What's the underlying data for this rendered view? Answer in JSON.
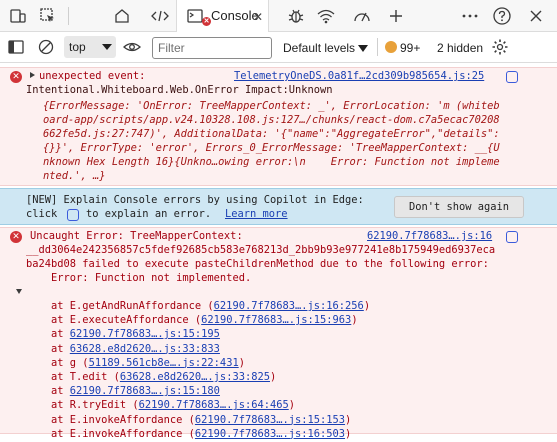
{
  "tabbar": {
    "console_label": "Console",
    "close_glyph": "✕",
    "error_badge": "✕",
    "icons": [
      "device-emulation-icon",
      "inspect-icon",
      "welcome-icon",
      "elements-icon",
      "console-icon",
      "debug-icon",
      "network-icon",
      "performance-icon",
      "more-tools-icon",
      "more-options-icon",
      "help-icon",
      "close-devtools-icon"
    ]
  },
  "toolbar": {
    "context": "top",
    "filter_placeholder": "Filter",
    "levels_label": "Default levels",
    "issues_count": "99+",
    "hidden_count": "2 hidden"
  },
  "messages": {
    "first": {
      "header": "unexpected event:",
      "source": "TelemetryOneDS.0a81f…2cd309b985654.js:25",
      "line2": "Intentional.Whiteboard.Web.OnError Impact:Unknown",
      "obj_lines": [
        "{ErrorMessage: 'OnError: TreeMapperContext: _', ErrorLocation: 'm (whiteb",
        "oard-app/scripts/app.v24.10328.108.js:127…/chunks/react-dom.c7a5ecac70208",
        "662fe5d.js:27:747)', AdditionalData: '{\"name\":\"AggregateError\",\"details\":",
        "{}}', ErrorType: 'error', Errors_0_ErrorMessage: 'TreeMapperContext: __{U",
        "nknown Hex Length 16}{Unkno…owing error:\\n    Error: Function not impleme",
        "nted.', …}"
      ]
    },
    "copilot": {
      "line1": "[NEW] Explain Console errors by using Copilot in Edge:",
      "line2_pre": "click",
      "line2_post": "to explain an error.",
      "learn_more": "Learn more",
      "dont_show": "Don't show again"
    },
    "second": {
      "header": "Uncaught Error: TreeMapperContext:",
      "header_source": "62190.7f78683….js:16",
      "lines": [
        "__dd3064e242356857c5fdef92685cb583e768213d_2bb9b93e977241e8b175949ed6937eca",
        "ba24bd08 failed to execute pasteChildrenMethod due to the following error:",
        "    Error: Function not implemented."
      ],
      "stack": [
        {
          "fn": "    at E.getAndRunAffordance (",
          "src": "62190.7f78683….js:16:256",
          "end": ")"
        },
        {
          "fn": "    at E.executeAffordance (",
          "src": "62190.7f78683….js:15:963",
          "end": ")"
        },
        {
          "fn": "    at ",
          "src": "62190.7f78683….js:15:195",
          "end": ""
        },
        {
          "fn": "    at ",
          "src": "63628.e8d2620….js:33:833",
          "end": ""
        },
        {
          "fn": "    at g (",
          "src": "51189.561cb8e….js:22:431",
          "end": ")"
        },
        {
          "fn": "    at T.edit (",
          "src": "63628.e8d2620….js:33:825",
          "end": ")"
        },
        {
          "fn": "    at ",
          "src": "62190.7f78683….js:15:180",
          "end": ""
        },
        {
          "fn": "    at R.tryEdit (",
          "src": "62190.7f78683….js:64:465",
          "end": ")"
        },
        {
          "fn": "    at E.invokeAffordance (",
          "src": "62190.7f78683….js:15:153",
          "end": ")"
        },
        {
          "fn": "    at E.invokeAffordance (",
          "src": "62190.7f78683….js:16:503",
          "end": ")"
        }
      ]
    }
  },
  "colors": {
    "error_red": "#d13438",
    "error_bg": "#fdf0f0",
    "copilot_bg": "#cfe7f3",
    "link_blue": "#1a3fb3"
  }
}
